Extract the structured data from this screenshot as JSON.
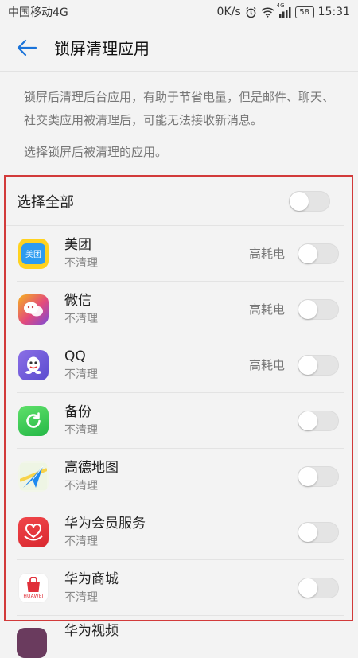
{
  "status_bar": {
    "carrier": "中国移动4G",
    "speed": "0K/s",
    "signal_badge": "4G",
    "battery": "58",
    "time": "15:31"
  },
  "header": {
    "title": "锁屏清理应用"
  },
  "description": "锁屏后清理后台应用，有助于节省电量，但是邮件、聊天、社交类应用被清理后，可能无法接收新消息。",
  "sub_label": "选择锁屏后被清理的应用。",
  "select_all": {
    "label": "选择全部",
    "enabled": false
  },
  "apps": [
    {
      "name": "美团",
      "status": "不清理",
      "badge": "高耗电",
      "icon_text": "美团",
      "icon": "meituan-icon",
      "enabled": false
    },
    {
      "name": "微信",
      "status": "不清理",
      "badge": "高耗电",
      "icon_text": "",
      "icon": "wechat-icon",
      "enabled": false
    },
    {
      "name": "QQ",
      "status": "不清理",
      "badge": "高耗电",
      "icon_text": "",
      "icon": "qq-icon",
      "enabled": false
    },
    {
      "name": "备份",
      "status": "不清理",
      "badge": "",
      "icon_text": "",
      "icon": "backup-icon",
      "enabled": false
    },
    {
      "name": "高德地图",
      "status": "不清理",
      "badge": "",
      "icon_text": "",
      "icon": "amap-icon",
      "enabled": false
    },
    {
      "name": "华为会员服务",
      "status": "不清理",
      "badge": "",
      "icon_text": "",
      "icon": "huawei-member-icon",
      "enabled": false
    },
    {
      "name": "华为商城",
      "status": "不清理",
      "badge": "",
      "icon_text": "HUAWEI",
      "icon": "huawei-mall-icon",
      "enabled": false
    }
  ],
  "partial_app": {
    "name": "华为视频",
    "icon": "huawei-video-icon"
  },
  "colors": {
    "accent": "#1a73d9",
    "highlight_border": "#d23a3a",
    "toggle_off": "#e4e4e4"
  }
}
